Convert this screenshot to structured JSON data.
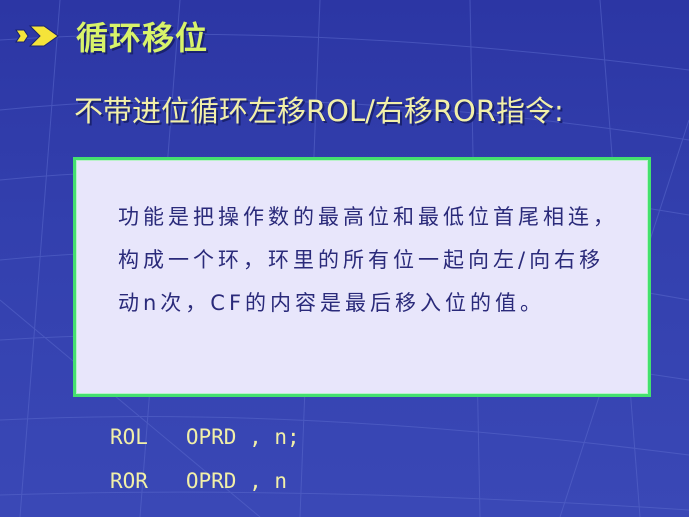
{
  "slide": {
    "title": "循环移位",
    "title_icon": "double-arrow-bullet-icon",
    "subtitle": "不带进位循环左移ROL/右移ROR指令:",
    "description": "功能是把操作数的最高位和最低位首尾相连，构成一个环，环里的所有位一起向左/向右移动n次，CF的内容是最后移入位的值。",
    "code_lines": [
      "ROL   OPRD , n;",
      "ROR   OPRD , n"
    ]
  },
  "colors": {
    "background": "#2f3aa8",
    "title": "#d8f36a",
    "subtitle": "#f2f0a8",
    "box_fill": "#e8e6fb",
    "box_border": "#44e06f",
    "box_text": "#2a2a7a",
    "icon_yellow": "#f5e43a"
  }
}
